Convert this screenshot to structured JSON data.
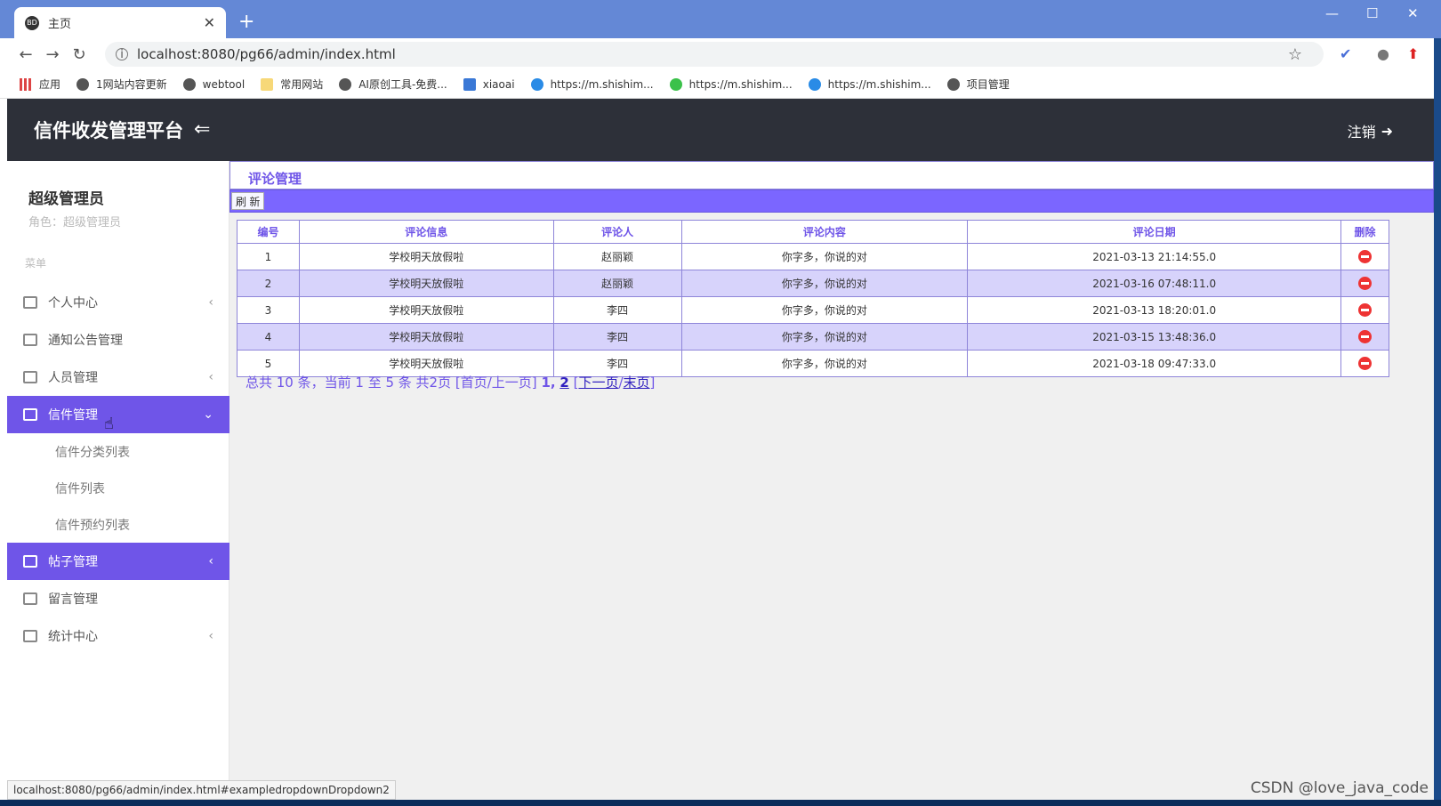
{
  "browser": {
    "tab_title": "主页",
    "tab_favicon": "BD",
    "url": "localhost:8080/pg66/admin/index.html",
    "bookmarks": [
      {
        "label": "应用",
        "icon": "grid-icon"
      },
      {
        "label": "1网站内容更新",
        "icon": "globe-icon"
      },
      {
        "label": "webtool",
        "icon": "globe-icon"
      },
      {
        "label": "常用网站",
        "icon": "folder-icon"
      },
      {
        "label": "AI原创工具-免费...",
        "icon": "globe-icon"
      },
      {
        "label": "xiaoai",
        "icon": "p-icon"
      },
      {
        "label": "https://m.shishim...",
        "icon": "c-icon"
      },
      {
        "label": "https://m.shishim...",
        "icon": "wechat-icon"
      },
      {
        "label": "https://m.shishim...",
        "icon": "c-icon"
      },
      {
        "label": "项目管理",
        "icon": "globe-icon"
      }
    ],
    "status_url": "localhost:8080/pg66/admin/index.html#exampledropdownDropdown2"
  },
  "header": {
    "brand": "信件收发管理平台",
    "logout_label": "注销"
  },
  "sidebar": {
    "user_name": "超级管理员",
    "user_role": "角色：超级管理员",
    "menu_label": "菜单",
    "items": [
      {
        "label": "个人中心",
        "has_chevron": true,
        "active": false
      },
      {
        "label": "通知公告管理",
        "has_chevron": false,
        "active": false
      },
      {
        "label": "人员管理",
        "has_chevron": true,
        "active": false
      },
      {
        "label": "信件管理",
        "has_chevron": true,
        "active": true,
        "expanded": true
      },
      {
        "label": "帖子管理",
        "has_chevron": true,
        "active": true
      },
      {
        "label": "留言管理",
        "has_chevron": false,
        "active": false
      },
      {
        "label": "统计中心",
        "has_chevron": true,
        "active": false
      }
    ],
    "sub_items": [
      "信件分类列表",
      "信件列表",
      "信件预约列表"
    ]
  },
  "main": {
    "title": "评论管理",
    "refresh_label": "刷 新",
    "columns": [
      "编号",
      "评论信息",
      "评论人",
      "评论内容",
      "评论日期",
      "删除"
    ],
    "rows": [
      [
        "1",
        "学校明天放假啦",
        "赵丽颖",
        "你字多，你说的对",
        "2021-03-13 21:14:55.0"
      ],
      [
        "2",
        "学校明天放假啦",
        "赵丽颖",
        "你字多，你说的对",
        "2021-03-16 07:48:11.0"
      ],
      [
        "3",
        "学校明天放假啦",
        "李四",
        "你字多，你说的对",
        "2021-03-13 18:20:01.0"
      ],
      [
        "4",
        "学校明天放假啦",
        "李四",
        "你字多，你说的对",
        "2021-03-15 13:48:36.0"
      ],
      [
        "5",
        "学校明天放假啦",
        "李四",
        "你字多，你说的对",
        "2021-03-18 09:47:33.0"
      ]
    ],
    "pager": {
      "summary": "总共 10 条，当前 1 至 5 条 共2页",
      "first_prev": "[首页/上一页]",
      "page1": "1,",
      "page2": "2",
      "next": "下一页",
      "last": "末页"
    }
  },
  "watermark": "CSDN @love_java_code",
  "colors": {
    "accent": "#6f55e8",
    "header_bg": "#2d3039",
    "row_alt": "#d7d3fb",
    "delete": "#e33333"
  }
}
